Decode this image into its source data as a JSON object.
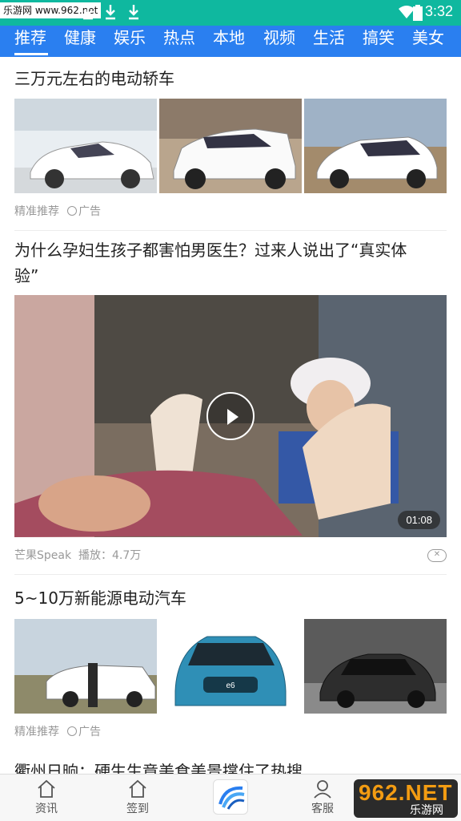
{
  "status_bar": {
    "watermark_tag": "乐游网 www.962.net",
    "time": "3:32",
    "icons": [
      "download-icon",
      "download-icon",
      "download-icon",
      "wifi-icon",
      "battery-icon"
    ]
  },
  "tabs": [
    {
      "label": "推荐",
      "active": true
    },
    {
      "label": "健康"
    },
    {
      "label": "娱乐"
    },
    {
      "label": "热点"
    },
    {
      "label": "本地"
    },
    {
      "label": "视频"
    },
    {
      "label": "生活"
    },
    {
      "label": "搞笑"
    },
    {
      "label": "美女"
    }
  ],
  "feed": [
    {
      "title": "三万元左右的电动轿车",
      "source": "精准推荐",
      "ad_label": "广告",
      "images": [
        "white-sedan-photo",
        "white-suv-photo",
        "white-hatchback-photo"
      ]
    },
    {
      "title_line1": "为什么孕妇生孩子都害怕男医生？过来人说出了“真实体",
      "title_line2": "验”",
      "source": "芒果Speak",
      "plays": "播放：4.7万",
      "duration": "01:08"
    },
    {
      "title": "5~10万新能源电动汽车",
      "source": "精准推荐",
      "ad_label": "广告",
      "images": [
        "white-cars-row-photo",
        "blue-byd-e6-photo",
        "dark-concept-car-photo"
      ]
    },
    {
      "title_cut": "衢州日晌：硬生生竟美食美景撑住了热搜"
    }
  ],
  "bottom_nav": [
    {
      "label": "资讯",
      "icon": "home-icon"
    },
    {
      "label": "签到",
      "icon": "home-icon"
    },
    {
      "label": "",
      "icon": "app-logo-icon"
    },
    {
      "label": "客服",
      "icon": "person-icon"
    }
  ],
  "watermark": {
    "big": "962.NET",
    "small": "乐游网"
  },
  "colors": {
    "status_bar": "#0fb89f",
    "tab_bar": "#2a7ff0",
    "text_primary": "#222222",
    "text_meta": "#999999"
  }
}
